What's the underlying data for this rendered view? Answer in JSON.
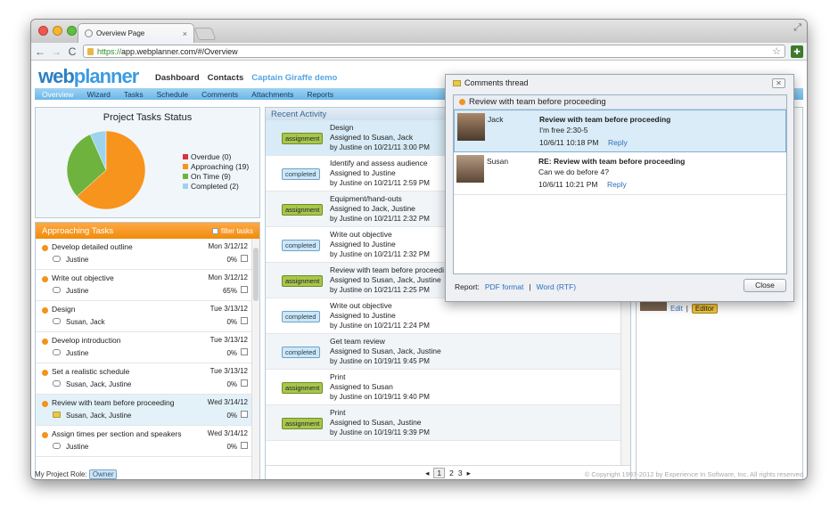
{
  "browser": {
    "tab_title": "Overview Page",
    "url_secure": "https://",
    "url_rest": "app.webplanner.com/#/Overview",
    "tab_close": "×",
    "back": "←",
    "forward": "→",
    "reload": "C",
    "star": "☆",
    "ext_label": "✚",
    "resize": "⤢"
  },
  "app": {
    "logo_a": "web",
    "logo_b": "planner",
    "topnav": [
      "Dashboard",
      "Contacts",
      "Captain Giraffe demo"
    ],
    "menu": [
      "Overview",
      "Wizard",
      "Tasks",
      "Schedule",
      "Comments",
      "Attachments",
      "Reports"
    ]
  },
  "status": {
    "title": "Project Tasks Status",
    "legend": [
      {
        "label": "Overdue (0)",
        "color": "#d9333f"
      },
      {
        "label": "Approaching (19)",
        "color": "#f7941d"
      },
      {
        "label": "On Time (9)",
        "color": "#6fb33f"
      },
      {
        "label": "Completed (2)",
        "color": "#9ed3ee"
      }
    ]
  },
  "approaching": {
    "title": "Approaching Tasks",
    "filter_label": "filter tasks",
    "tasks": [
      {
        "name": "Develop detailed outline",
        "date": "Mon 3/12/12",
        "people": "Justine",
        "pct": "0%"
      },
      {
        "name": "Write out objective",
        "date": "Mon 3/12/12",
        "people": "Justine",
        "pct": "65%"
      },
      {
        "name": "Design",
        "date": "Tue 3/13/12",
        "people": "Susan, Jack",
        "pct": "0%"
      },
      {
        "name": "Develop introduction",
        "date": "Tue 3/13/12",
        "people": "Justine",
        "pct": "0%"
      },
      {
        "name": "Set a realistic schedule",
        "date": "Tue 3/13/12",
        "people": "Susan, Jack, Justine",
        "pct": "0%"
      },
      {
        "name": "Review with team before proceeding",
        "date": "Wed 3/14/12",
        "people": "Susan, Jack, Justine",
        "pct": "0%"
      },
      {
        "name": "Assign times per section and speakers",
        "date": "Wed 3/14/12",
        "people": "Justine",
        "pct": "0%"
      }
    ]
  },
  "activity": {
    "title": "Recent Activity",
    "items": [
      {
        "badge": "assignment",
        "title": "Design",
        "detail": "Assigned to Susan, Jack",
        "by": "by Justine on 10/21/11 3:00 PM"
      },
      {
        "badge": "completed",
        "title": "Identify and assess audience",
        "detail": "Assigned to Justine",
        "by": "by Justine on 10/21/11 2:59 PM"
      },
      {
        "badge": "assignment",
        "title": "Equipment/hand-outs",
        "detail": "Assigned to Jack, Justine",
        "by": "by Justine on 10/21/11 2:32 PM"
      },
      {
        "badge": "completed",
        "title": "Write out objective",
        "detail": "Assigned to Justine",
        "by": "by Justine on 10/21/11 2:32 PM"
      },
      {
        "badge": "assignment",
        "title": "Review with team before proceedi",
        "detail": "Assigned to Susan, Jack, Justine",
        "by": "by Justine on 10/21/11 2:25 PM"
      },
      {
        "badge": "completed",
        "title": "Write out objective",
        "detail": "Assigned to Justine",
        "by": "by Justine on 10/21/11 2:24 PM"
      },
      {
        "badge": "completed",
        "title": "Get team review",
        "detail": "Assigned to Susan, Jack, Justine",
        "by": "by Justine on 10/19/11 9:45 PM"
      },
      {
        "badge": "assignment",
        "title": "Print",
        "detail": "Assigned to Susan",
        "by": "by Justine on 10/19/11 9:40 PM"
      },
      {
        "badge": "assignment",
        "title": "Print",
        "detail": "Assigned to Susan, Justine",
        "by": "by Justine on 10/19/11 9:39 PM"
      }
    ],
    "pages": [
      "1",
      "2",
      "3"
    ],
    "prev": "◂",
    "next": "▸"
  },
  "right": {
    "edit_label": "Edit",
    "separator": "|",
    "editor_label": "Editor"
  },
  "footer": {
    "role_label": "My Project Role:",
    "role_value": "Owner",
    "copyright": "© Copyright 1997-2012 by Experience In Software, Inc. All rights reserved"
  },
  "popup": {
    "title": "Comments thread",
    "close_x": "✕",
    "thread_title": "Review with team before proceeding",
    "comments": [
      {
        "author": "Jack",
        "subject": "Review with team before proceeding",
        "body": "I'm free 2:30-5",
        "time": "10/6/11 10:18 PM",
        "reply": "Reply"
      },
      {
        "author": "Susan",
        "subject": "RE: Review with team before proceeding",
        "body": "Can we do before 4?",
        "time": "10/6/11 10:21 PM",
        "reply": "Reply"
      }
    ],
    "report_label": "Report:",
    "pdf": "PDF format",
    "sep": "|",
    "word": "Word (RTF)",
    "close": "Close"
  }
}
